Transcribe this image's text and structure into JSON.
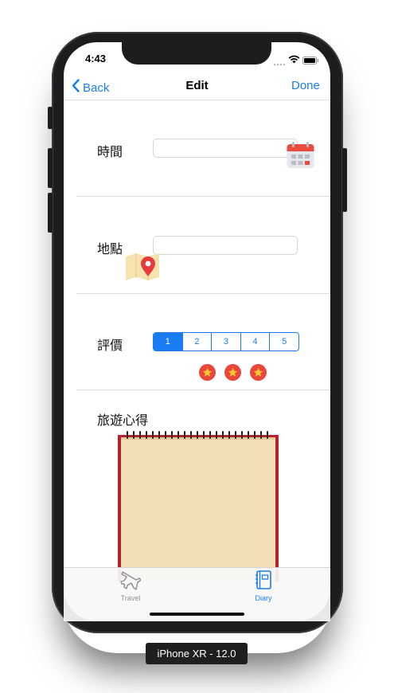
{
  "status_bar": {
    "time": "4:43"
  },
  "nav": {
    "back_label": "Back",
    "title": "Edit",
    "done_label": "Done"
  },
  "form": {
    "time_label": "時間",
    "time_value": "",
    "location_label": "地點",
    "location_value": "",
    "rating_label": "評價",
    "rating_options": [
      "1",
      "2",
      "3",
      "4",
      "5"
    ],
    "rating_selected": "1",
    "stars_shown": 3,
    "notes_label": "旅遊心得"
  },
  "tabbar": {
    "tabs": [
      {
        "label": "Travel",
        "icon": "airplane-icon"
      },
      {
        "label": "Diary",
        "icon": "diary-icon",
        "active": true
      }
    ]
  },
  "device_label": "iPhone XR - 12.0",
  "colors": {
    "accent": "#1a7cf3",
    "star_badge": "#e8463c",
    "notebook_paper": "#f2dfb7",
    "notebook_cover": "#b5222d"
  }
}
